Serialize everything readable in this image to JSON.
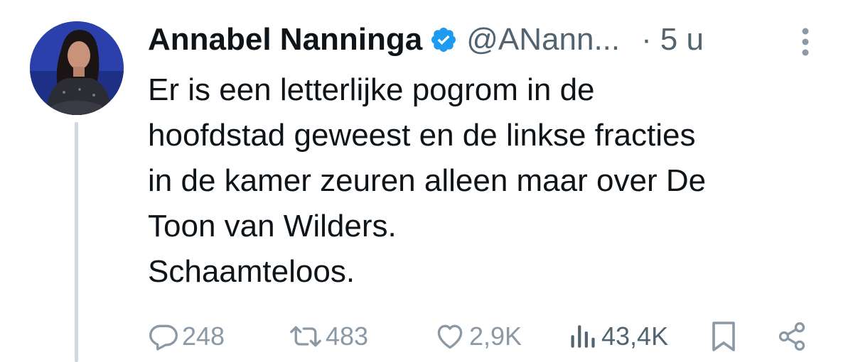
{
  "tweet": {
    "author_name": "Annabel Nanninga",
    "handle": "@ANann...",
    "separator": "·",
    "time": "5 u",
    "text_lines": [
      "Er is een letterlijke pogrom in de",
      "hoofdstad geweest en de linkse fracties",
      "in de kamer zeuren alleen maar over De",
      "Toon van Wilders.",
      "Schaamteloos."
    ],
    "actions": {
      "replies": "248",
      "reposts": "483",
      "likes": "2,9K",
      "views": "43,4K"
    }
  },
  "icons": {
    "verified": "verified-badge-icon",
    "more": "more-options-icon",
    "reply": "reply-icon",
    "repost": "repost-icon",
    "like": "heart-icon",
    "views": "views-icon",
    "bookmark": "bookmark-icon",
    "share": "share-icon"
  },
  "colors": {
    "text": "#0f1419",
    "secondary": "#536471",
    "action_gray": "#8b98a5",
    "verified_blue": "#1d9bf0",
    "thread_line": "#cfd9de"
  }
}
